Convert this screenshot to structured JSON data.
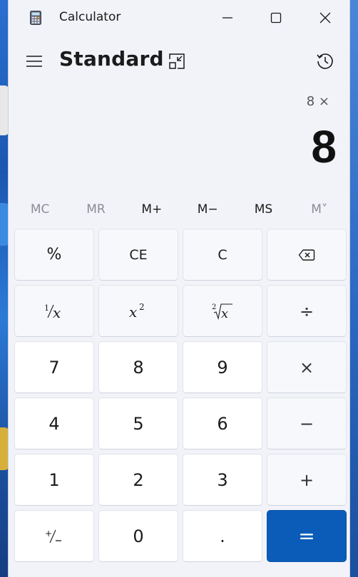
{
  "window": {
    "title": "Calculator"
  },
  "header": {
    "mode": "Standard"
  },
  "display": {
    "expression": "8 ×",
    "result": "8"
  },
  "memory": [
    {
      "label": "MC",
      "enabled": false
    },
    {
      "label": "MR",
      "enabled": false
    },
    {
      "label": "M+",
      "enabled": true
    },
    {
      "label": "M−",
      "enabled": true
    },
    {
      "label": "MS",
      "enabled": true
    },
    {
      "label": "M˅",
      "enabled": false
    }
  ],
  "keys": {
    "percent": "%",
    "ce": "CE",
    "c": "C",
    "seven": "7",
    "eight": "8",
    "nine": "9",
    "four": "4",
    "five": "5",
    "six": "6",
    "one": "1",
    "two": "2",
    "three": "3",
    "zero": "0",
    "decimal": ".",
    "multiply": "×",
    "minus": "−",
    "plus": "+",
    "divide": "÷",
    "equals": "="
  },
  "colors": {
    "accent": "#0a5cb8",
    "window_bg": "#f1f3f9",
    "key_bg": "#ffffff"
  },
  "icons": [
    "calculator-icon",
    "minimize-icon",
    "maximize-icon",
    "close-icon",
    "hamburger-menu-icon",
    "keep-on-top-icon",
    "history-icon",
    "backspace-icon"
  ]
}
